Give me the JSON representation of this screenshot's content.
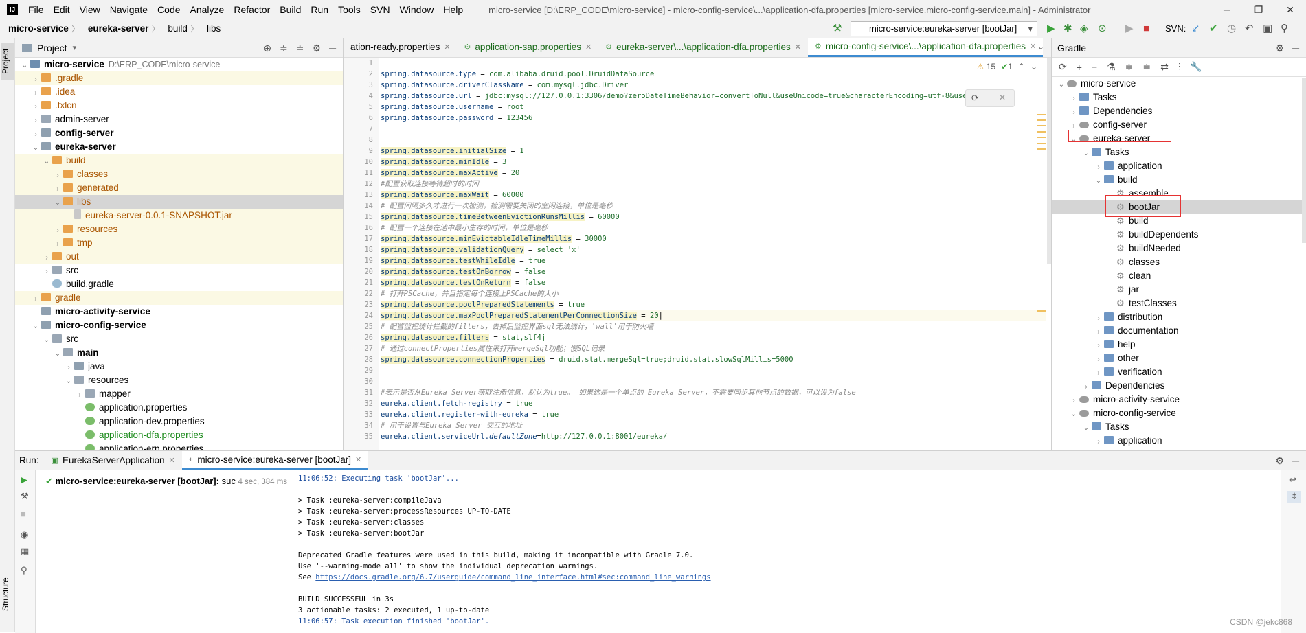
{
  "menubar": {
    "items": [
      "File",
      "Edit",
      "View",
      "Navigate",
      "Code",
      "Analyze",
      "Refactor",
      "Build",
      "Run",
      "Tools",
      "SVN",
      "Window",
      "Help"
    ],
    "title": "micro-service [D:\\ERP_CODE\\micro-service] - micro-config-service\\...\\application-dfa.properties [micro-service.micro-config-service.main] - Administrator"
  },
  "navbar": {
    "crumbs": [
      "micro-service",
      "eureka-server",
      "build",
      "libs"
    ],
    "run_config": "micro-service:eureka-server [bootJar]",
    "svn_label": "SVN:"
  },
  "project": {
    "title": "Project",
    "rows": [
      {
        "depth": 0,
        "arrow": "v",
        "icon": "mod",
        "name": "micro-service",
        "extra": "D:\\ERP_CODE\\micro-service",
        "style": "root"
      },
      {
        "depth": 1,
        "arrow": ">",
        "icon": "fo",
        "name": ".gradle",
        "style": "brown",
        "yel": true
      },
      {
        "depth": 1,
        "arrow": ">",
        "icon": "fo",
        "name": ".idea",
        "style": "brown"
      },
      {
        "depth": 1,
        "arrow": ">",
        "icon": "fo",
        "name": ".txlcn",
        "style": "brown"
      },
      {
        "depth": 1,
        "arrow": ">",
        "icon": "fg",
        "name": "admin-server",
        "style": ""
      },
      {
        "depth": 1,
        "arrow": ">",
        "icon": "fb",
        "name": "config-server",
        "style": "bold"
      },
      {
        "depth": 1,
        "arrow": "v",
        "icon": "fb",
        "name": "eureka-server",
        "style": "bold"
      },
      {
        "depth": 2,
        "arrow": "v",
        "icon": "fo",
        "name": "build",
        "style": "brown",
        "yel": true
      },
      {
        "depth": 3,
        "arrow": ">",
        "icon": "fo",
        "name": "classes",
        "style": "brown",
        "yel": true
      },
      {
        "depth": 3,
        "arrow": ">",
        "icon": "fo",
        "name": "generated",
        "style": "brown",
        "yel": true
      },
      {
        "depth": 3,
        "arrow": "v",
        "icon": "fo",
        "name": "libs",
        "style": "brown",
        "sel": true
      },
      {
        "depth": 4,
        "arrow": "",
        "icon": "jar",
        "name": "eureka-server-0.0.1-SNAPSHOT.jar",
        "style": "brown",
        "yel": true
      },
      {
        "depth": 3,
        "arrow": ">",
        "icon": "fo",
        "name": "resources",
        "style": "brown",
        "yel": true
      },
      {
        "depth": 3,
        "arrow": ">",
        "icon": "fo",
        "name": "tmp",
        "style": "brown",
        "yel": true
      },
      {
        "depth": 2,
        "arrow": ">",
        "icon": "fo",
        "name": "out",
        "style": "brown",
        "yel": true
      },
      {
        "depth": 2,
        "arrow": ">",
        "icon": "fg",
        "name": "src",
        "style": ""
      },
      {
        "depth": 2,
        "arrow": "",
        "icon": "gr",
        "name": "build.gradle",
        "style": ""
      },
      {
        "depth": 1,
        "arrow": ">",
        "icon": "fo",
        "name": "gradle",
        "style": "brown",
        "yel": true
      },
      {
        "depth": 1,
        "arrow": "",
        "icon": "fb",
        "name": "micro-activity-service",
        "style": "bold"
      },
      {
        "depth": 1,
        "arrow": "v",
        "icon": "fb",
        "name": "micro-config-service",
        "style": "bold"
      },
      {
        "depth": 2,
        "arrow": "v",
        "icon": "fg",
        "name": "src",
        "style": ""
      },
      {
        "depth": 3,
        "arrow": "v",
        "icon": "fg",
        "name": "main",
        "style": "bold"
      },
      {
        "depth": 4,
        "arrow": ">",
        "icon": "fb",
        "name": "java",
        "style": ""
      },
      {
        "depth": 4,
        "arrow": "v",
        "icon": "fg",
        "name": "resources",
        "style": ""
      },
      {
        "depth": 5,
        "arrow": ">",
        "icon": "fg",
        "name": "mapper",
        "style": ""
      },
      {
        "depth": 5,
        "arrow": "",
        "icon": "prop",
        "name": "application.properties",
        "style": ""
      },
      {
        "depth": 5,
        "arrow": "",
        "icon": "prop",
        "name": "application-dev.properties",
        "style": ""
      },
      {
        "depth": 5,
        "arrow": "",
        "icon": "prop",
        "name": "application-dfa.properties",
        "style": "green"
      },
      {
        "depth": 5,
        "arrow": "",
        "icon": "prop",
        "name": "application-erp.properties",
        "style": ""
      }
    ]
  },
  "editor": {
    "tabs": [
      {
        "label": "ation-ready.properties",
        "active": false
      },
      {
        "label": "application-sap.properties",
        "active": false
      },
      {
        "label": "eureka-server\\...\\application-dfa.properties",
        "active": false
      },
      {
        "label": "micro-config-service\\...\\application-dfa.properties",
        "active": true
      }
    ],
    "inspection": {
      "warnings": "15",
      "checks": "1"
    },
    "lines": [
      {
        "n": "1",
        "t": ""
      },
      {
        "n": "2",
        "k": "spring.datasource.type",
        "v": "com.alibaba.druid.pool.DruidDataSource"
      },
      {
        "n": "3",
        "k": "spring.datasource.driverClassName",
        "v": "com.mysql.jdbc.Driver"
      },
      {
        "n": "4",
        "k": "spring.datasource.url",
        "v": "jdbc:mysql://127.0.0.1:3306/demo?zeroDateTimeBehavior=convertToNull&useUnicode=true&characterEncoding=utf-8&useSSL=false"
      },
      {
        "n": "5",
        "k": "spring.datasource.username",
        "v": "root"
      },
      {
        "n": "6",
        "k": "spring.datasource.password",
        "v": "123456"
      },
      {
        "n": "7",
        "t": ""
      },
      {
        "n": "8",
        "t": ""
      },
      {
        "n": "9",
        "k": "spring.datasource.initialSize",
        "v": "1",
        "h": true
      },
      {
        "n": "10",
        "k": "spring.datasource.minIdle",
        "v": "3",
        "h": true
      },
      {
        "n": "11",
        "k": "spring.datasource.maxActive",
        "v": "20",
        "h": true
      },
      {
        "n": "12",
        "c": "#配置获取连接等待超时的时间"
      },
      {
        "n": "13",
        "k": "spring.datasource.maxWait",
        "v": "60000",
        "h": true
      },
      {
        "n": "14",
        "c": "# 配置间隔多久才进行一次检测，检测需要关闭的空闲连接，单位是毫秒"
      },
      {
        "n": "15",
        "k": "spring.datasource.timeBetweenEvictionRunsMillis",
        "v": "60000",
        "h": true
      },
      {
        "n": "16",
        "c": "# 配置一个连接在池中最小生存的时间，单位是毫秒"
      },
      {
        "n": "17",
        "k": "spring.datasource.minEvictableIdleTimeMillis",
        "v": "30000",
        "h": true
      },
      {
        "n": "18",
        "k": "spring.datasource.validationQuery",
        "v": "select 'x'",
        "h": true
      },
      {
        "n": "19",
        "k": "spring.datasource.testWhileIdle",
        "v": "true",
        "h": true
      },
      {
        "n": "20",
        "k": "spring.datasource.testOnBorrow",
        "v": "false",
        "h": true
      },
      {
        "n": "21",
        "k": "spring.datasource.testOnReturn",
        "v": "false",
        "h": true
      },
      {
        "n": "22",
        "c": "# 打开PSCache，并且指定每个连接上PSCache的大小"
      },
      {
        "n": "23",
        "k": "spring.datasource.poolPreparedStatements",
        "v": "true",
        "h": true
      },
      {
        "n": "24",
        "k": "spring.datasource.maxPoolPreparedStatementPerConnectionSize",
        "v": "20",
        "h": true,
        "cur": true
      },
      {
        "n": "25",
        "c": "# 配置监控统计拦截的filters，去掉后监控界面sql无法统计，'wall'用于防火墙"
      },
      {
        "n": "26",
        "k": "spring.datasource.filters",
        "v": "stat,slf4j",
        "h": true
      },
      {
        "n": "27",
        "c": "# 通过connectProperties属性来打开mergeSql功能；慢SQL记录"
      },
      {
        "n": "28",
        "k": "spring.datasource.connectionProperties",
        "v": "druid.stat.mergeSql=true;druid.stat.slowSqlMillis=5000",
        "h": true
      },
      {
        "n": "29",
        "t": ""
      },
      {
        "n": "30",
        "t": ""
      },
      {
        "n": "31",
        "c": "#表示是否从Eureka Server获取注册信息，默认为true。 如果这是一个单点的 Eureka Server，不需要同步其他节点的数据，可以设为false"
      },
      {
        "n": "32",
        "k": "eureka.client.fetch-registry",
        "v": "true"
      },
      {
        "n": "33",
        "k": "eureka.client.register-with-eureka",
        "v": "true"
      },
      {
        "n": "34",
        "c": "# 用于设置与Eureka Server 交互的地址"
      },
      {
        "n": "35",
        "k": "eureka.client.serviceUrl.",
        "kd": "defaultZone",
        "v": "http://127.0.0.1:8001/eureka/"
      }
    ]
  },
  "gradle": {
    "title": "Gradle",
    "rows": [
      {
        "depth": 0,
        "arrow": "v",
        "icon": "el",
        "name": "micro-service"
      },
      {
        "depth": 1,
        "arrow": ">",
        "icon": "task",
        "name": "Tasks"
      },
      {
        "depth": 1,
        "arrow": ">",
        "icon": "task",
        "name": "Dependencies"
      },
      {
        "depth": 1,
        "arrow": ">",
        "icon": "el",
        "name": "config-server"
      },
      {
        "depth": 1,
        "arrow": "v",
        "icon": "el",
        "name": "eureka-server",
        "boxed": true
      },
      {
        "depth": 2,
        "arrow": "v",
        "icon": "task",
        "name": "Tasks"
      },
      {
        "depth": 3,
        "arrow": ">",
        "icon": "task",
        "name": "application"
      },
      {
        "depth": 3,
        "arrow": "v",
        "icon": "task",
        "name": "build"
      },
      {
        "depth": 4,
        "arrow": "",
        "icon": "gear",
        "name": "assemble"
      },
      {
        "depth": 4,
        "arrow": "",
        "icon": "gear",
        "name": "bootJar",
        "sel": true,
        "boxed": true
      },
      {
        "depth": 4,
        "arrow": "",
        "icon": "gear",
        "name": "build"
      },
      {
        "depth": 4,
        "arrow": "",
        "icon": "gear",
        "name": "buildDependents"
      },
      {
        "depth": 4,
        "arrow": "",
        "icon": "gear",
        "name": "buildNeeded"
      },
      {
        "depth": 4,
        "arrow": "",
        "icon": "gear",
        "name": "classes"
      },
      {
        "depth": 4,
        "arrow": "",
        "icon": "gear",
        "name": "clean"
      },
      {
        "depth": 4,
        "arrow": "",
        "icon": "gear",
        "name": "jar"
      },
      {
        "depth": 4,
        "arrow": "",
        "icon": "gear",
        "name": "testClasses"
      },
      {
        "depth": 3,
        "arrow": ">",
        "icon": "task",
        "name": "distribution"
      },
      {
        "depth": 3,
        "arrow": ">",
        "icon": "task",
        "name": "documentation"
      },
      {
        "depth": 3,
        "arrow": ">",
        "icon": "task",
        "name": "help"
      },
      {
        "depth": 3,
        "arrow": ">",
        "icon": "task",
        "name": "other"
      },
      {
        "depth": 3,
        "arrow": ">",
        "icon": "task",
        "name": "verification"
      },
      {
        "depth": 2,
        "arrow": ">",
        "icon": "task",
        "name": "Dependencies"
      },
      {
        "depth": 1,
        "arrow": ">",
        "icon": "el",
        "name": "micro-activity-service"
      },
      {
        "depth": 1,
        "arrow": "v",
        "icon": "el",
        "name": "micro-config-service"
      },
      {
        "depth": 2,
        "arrow": "v",
        "icon": "task",
        "name": "Tasks"
      },
      {
        "depth": 3,
        "arrow": ">",
        "icon": "task",
        "name": "application"
      }
    ]
  },
  "run": {
    "label": "Run:",
    "tabs": [
      "EurekaServerApplication",
      "micro-service:eureka-server [bootJar]"
    ],
    "tree_item": "micro-service:eureka-server [bootJar]:",
    "tree_status": "suc",
    "tree_time": "4 sec, 384 ms",
    "console": [
      {
        "t": "11:06:52: Executing task 'bootJar'...",
        "c": "blue"
      },
      {
        "t": "",
        "c": ""
      },
      {
        "t": "> Task :eureka-server:compileJava",
        "c": ""
      },
      {
        "t": "> Task :eureka-server:processResources UP-TO-DATE",
        "c": ""
      },
      {
        "t": "> Task :eureka-server:classes",
        "c": ""
      },
      {
        "t": "> Task :eureka-server:bootJar",
        "c": ""
      },
      {
        "t": "",
        "c": ""
      },
      {
        "t": "Deprecated Gradle features were used in this build, making it incompatible with Gradle 7.0.",
        "c": ""
      },
      {
        "t": "Use '--warning-mode all' to show the individual deprecation warnings.",
        "c": ""
      },
      {
        "t": "See ",
        "c": "",
        "link": "https://docs.gradle.org/6.7/userguide/command_line_interface.html#sec:command_line_warnings"
      },
      {
        "t": "",
        "c": ""
      },
      {
        "t": "BUILD SUCCESSFUL in 3s",
        "c": ""
      },
      {
        "t": "3 actionable tasks: 2 executed, 1 up-to-date",
        "c": ""
      },
      {
        "t": "11:06:57: Task execution finished 'bootJar'.",
        "c": "blue"
      }
    ]
  },
  "side_tabs": {
    "project": "Project",
    "structure": "Structure"
  },
  "watermark": "CSDN @jekc868"
}
